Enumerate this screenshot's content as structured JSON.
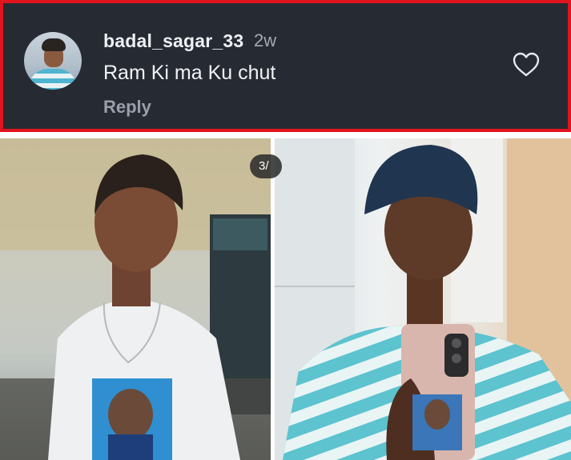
{
  "comment": {
    "username": "badal_sagar_33",
    "time": "2w",
    "text": "Ram Ki ma Ku chut",
    "reply_label": "Reply",
    "icons": {
      "avatar": "profile-avatar",
      "like": "heart-outline-icon"
    }
  },
  "media": {
    "page_indicator": "3/",
    "photos": [
      "person-standing-white-tshirt",
      "person-mirror-selfie-striped-shirt"
    ]
  },
  "colors": {
    "card_background": "#262a33",
    "highlight_border": "#e0141e",
    "username": "#eef0f3",
    "secondary_text": "#a3a8b2"
  }
}
